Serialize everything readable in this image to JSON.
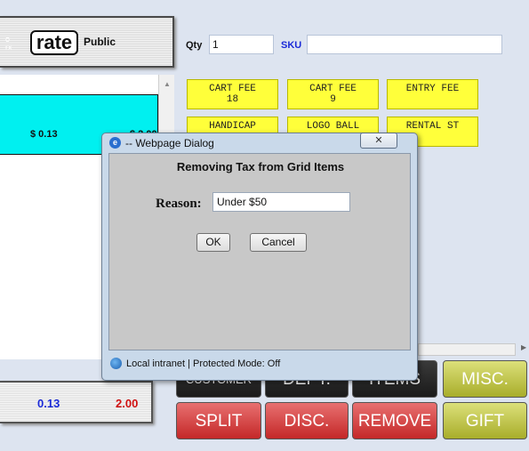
{
  "header": {
    "side_label": "o\nrx",
    "rate_label": "rate",
    "price_level": "Public"
  },
  "entry": {
    "qty_label": "Qty",
    "qty_value": "1",
    "sku_label": "SKU",
    "sku_value": ""
  },
  "grid": {
    "rows": [
      {
        "tax": "$ 0.13",
        "amount": "$ 2.00"
      }
    ]
  },
  "items": [
    {
      "line1": "CART FEE",
      "line2": "18"
    },
    {
      "line1": "CART FEE",
      "line2": "9"
    },
    {
      "line1": "ENTRY FEE",
      "line2": ""
    },
    {
      "line1": "HANDICAP",
      "line2": ""
    },
    {
      "line1": "LOGO BALL",
      "line2": ""
    },
    {
      "line1": "RENTAL ST",
      "line2": ""
    }
  ],
  "totals": {
    "tax": "0.13",
    "total": "2.00"
  },
  "buttons": {
    "customer": "CUSTOMER",
    "dept": "DEPT.",
    "items": "ITEMS",
    "misc": "MISC.",
    "split": "SPLIT",
    "disc": "DISC.",
    "remove": "REMOVE",
    "gift": "GIFT"
  },
  "dialog": {
    "title": "-- Webpage Dialog",
    "heading": "Removing Tax from Grid Items",
    "reason_label": "Reason:",
    "reason_value": "Under $50",
    "ok_label": "OK",
    "cancel_label": "Cancel",
    "close_glyph": "✕",
    "status": "Local intranet | Protected Mode: Off"
  },
  "colors": {
    "item_yellow": "#ffff3a",
    "grid_cyan": "#00f0f0",
    "tax_blue": "#1a2ad8",
    "total_red": "#d01010",
    "btn_red": "#c42828",
    "btn_olive": "#a8ad2a"
  }
}
